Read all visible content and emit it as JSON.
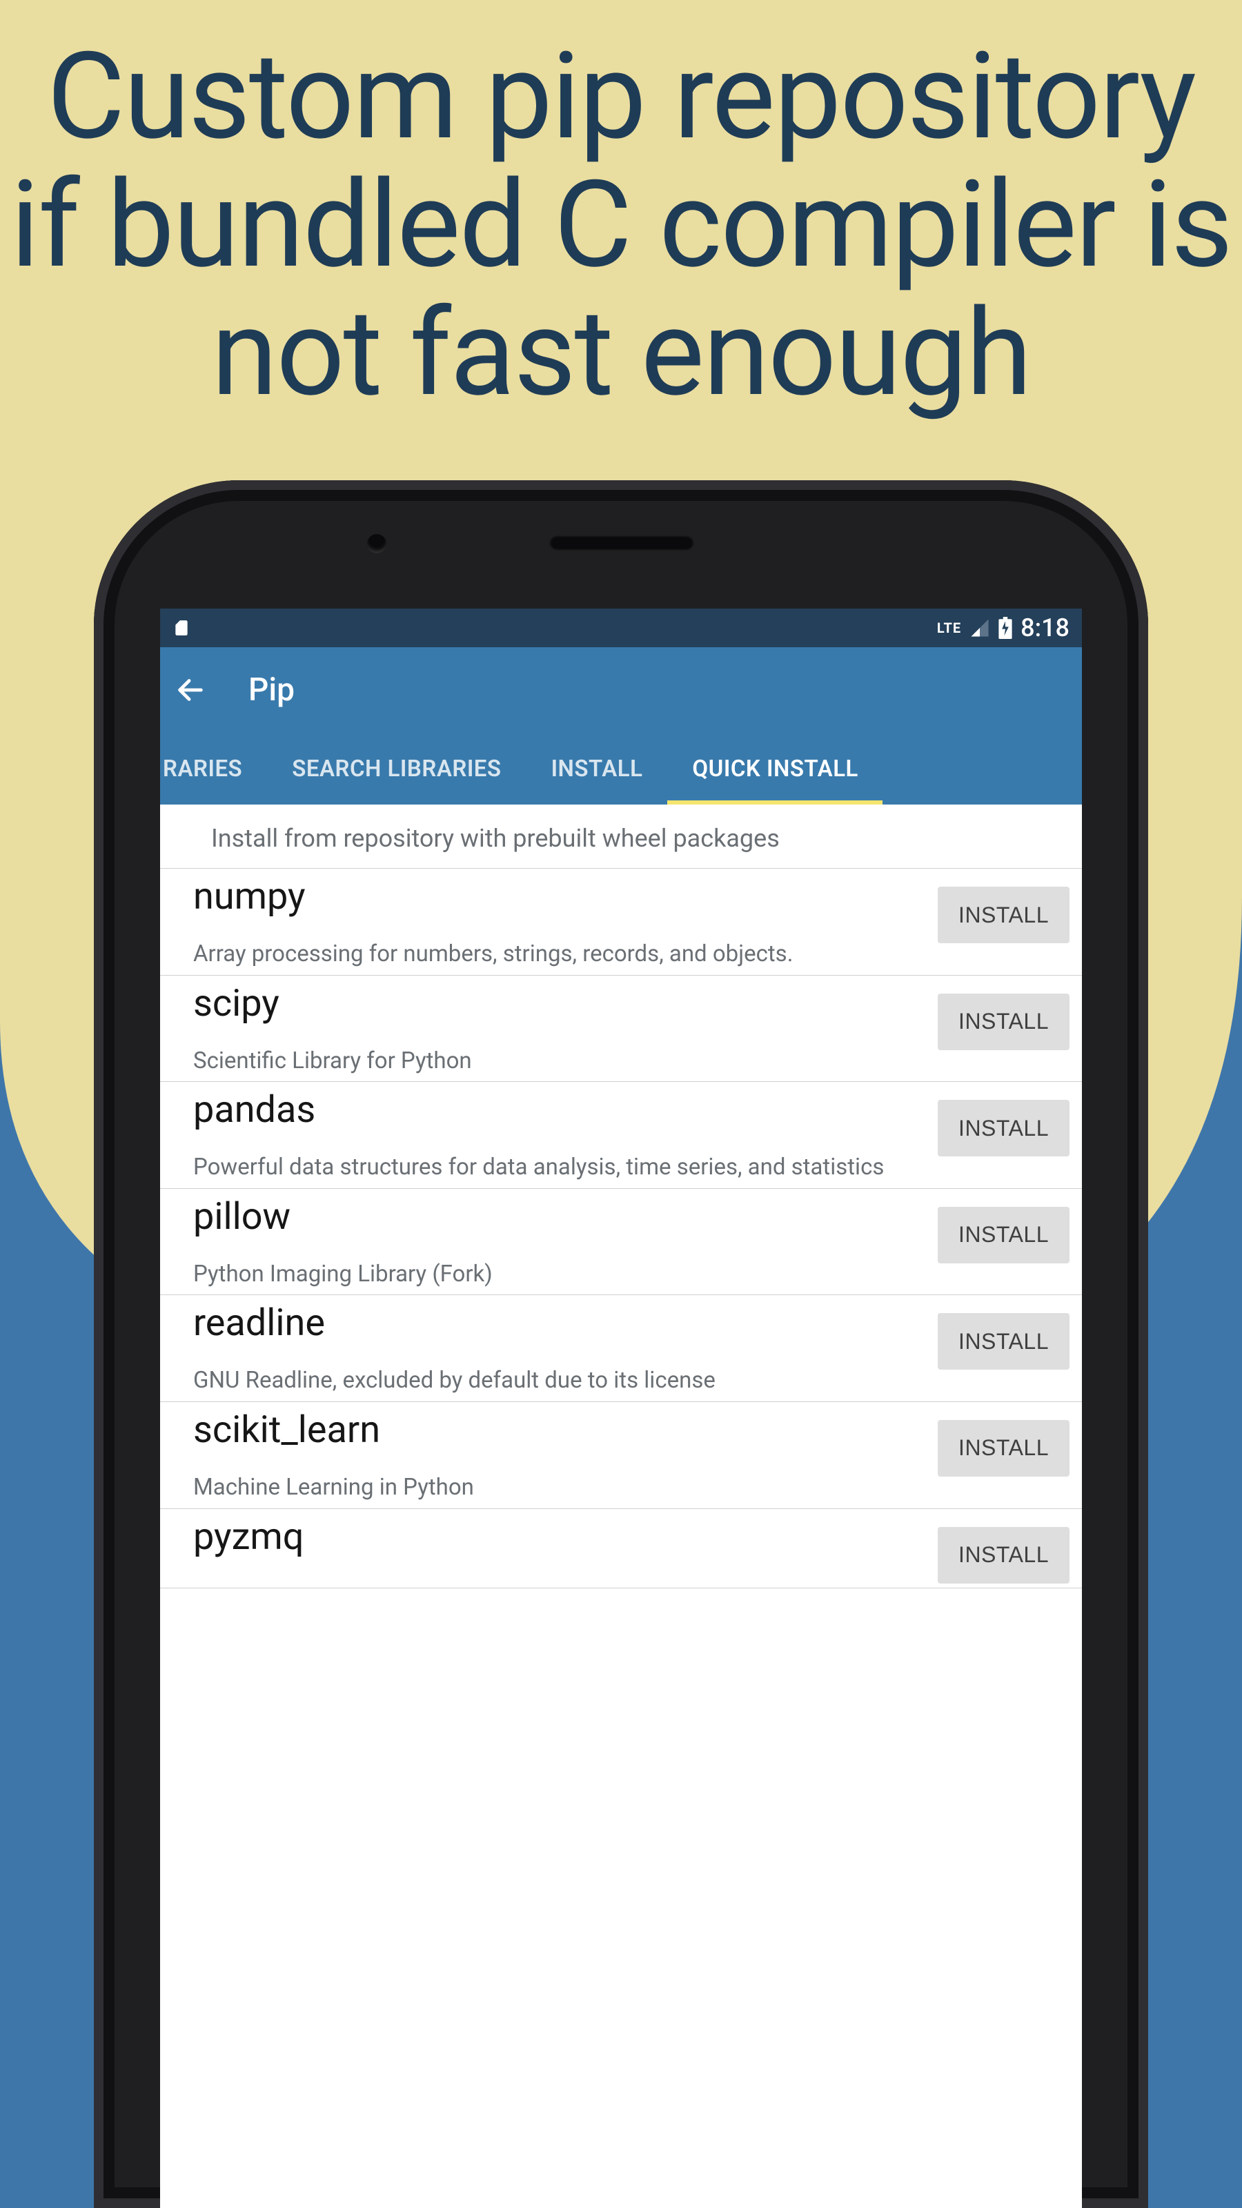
{
  "promo": {
    "title": "Custom pip repository if bundled C compiler is not fast enough"
  },
  "statusbar": {
    "lte": "LTE",
    "clock": "8:18"
  },
  "appbar": {
    "title": "Pip"
  },
  "tabs": {
    "items": [
      {
        "label": "RARIES",
        "active": false
      },
      {
        "label": "SEARCH LIBRARIES",
        "active": false
      },
      {
        "label": "INSTALL",
        "active": false
      },
      {
        "label": "QUICK INSTALL",
        "active": true
      }
    ]
  },
  "content": {
    "helper": "Install from repository with prebuilt wheel packages",
    "install_button_label": "INSTALL",
    "packages": [
      {
        "name": "numpy",
        "desc": "Array processing for numbers, strings, records, and objects."
      },
      {
        "name": "scipy",
        "desc": "Scientific Library for Python"
      },
      {
        "name": "pandas",
        "desc": "Powerful data structures for data analysis, time series, and statistics"
      },
      {
        "name": "pillow",
        "desc": "Python Imaging Library (Fork)"
      },
      {
        "name": "readline",
        "desc": "GNU Readline, excluded by default due to its license"
      },
      {
        "name": "scikit_learn",
        "desc": "Machine Learning in Python"
      },
      {
        "name": "pyzmq",
        "desc": ""
      }
    ]
  }
}
